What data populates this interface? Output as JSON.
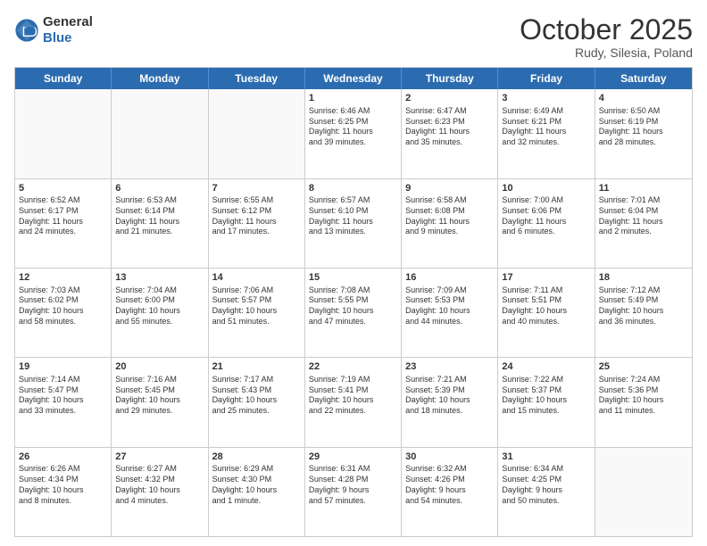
{
  "header": {
    "logo_general": "General",
    "logo_blue": "Blue",
    "month": "October 2025",
    "location": "Rudy, Silesia, Poland"
  },
  "weekdays": [
    "Sunday",
    "Monday",
    "Tuesday",
    "Wednesday",
    "Thursday",
    "Friday",
    "Saturday"
  ],
  "weeks": [
    [
      {
        "day": "",
        "text": ""
      },
      {
        "day": "",
        "text": ""
      },
      {
        "day": "",
        "text": ""
      },
      {
        "day": "1",
        "text": "Sunrise: 6:46 AM\nSunset: 6:25 PM\nDaylight: 11 hours\nand 39 minutes."
      },
      {
        "day": "2",
        "text": "Sunrise: 6:47 AM\nSunset: 6:23 PM\nDaylight: 11 hours\nand 35 minutes."
      },
      {
        "day": "3",
        "text": "Sunrise: 6:49 AM\nSunset: 6:21 PM\nDaylight: 11 hours\nand 32 minutes."
      },
      {
        "day": "4",
        "text": "Sunrise: 6:50 AM\nSunset: 6:19 PM\nDaylight: 11 hours\nand 28 minutes."
      }
    ],
    [
      {
        "day": "5",
        "text": "Sunrise: 6:52 AM\nSunset: 6:17 PM\nDaylight: 11 hours\nand 24 minutes."
      },
      {
        "day": "6",
        "text": "Sunrise: 6:53 AM\nSunset: 6:14 PM\nDaylight: 11 hours\nand 21 minutes."
      },
      {
        "day": "7",
        "text": "Sunrise: 6:55 AM\nSunset: 6:12 PM\nDaylight: 11 hours\nand 17 minutes."
      },
      {
        "day": "8",
        "text": "Sunrise: 6:57 AM\nSunset: 6:10 PM\nDaylight: 11 hours\nand 13 minutes."
      },
      {
        "day": "9",
        "text": "Sunrise: 6:58 AM\nSunset: 6:08 PM\nDaylight: 11 hours\nand 9 minutes."
      },
      {
        "day": "10",
        "text": "Sunrise: 7:00 AM\nSunset: 6:06 PM\nDaylight: 11 hours\nand 6 minutes."
      },
      {
        "day": "11",
        "text": "Sunrise: 7:01 AM\nSunset: 6:04 PM\nDaylight: 11 hours\nand 2 minutes."
      }
    ],
    [
      {
        "day": "12",
        "text": "Sunrise: 7:03 AM\nSunset: 6:02 PM\nDaylight: 10 hours\nand 58 minutes."
      },
      {
        "day": "13",
        "text": "Sunrise: 7:04 AM\nSunset: 6:00 PM\nDaylight: 10 hours\nand 55 minutes."
      },
      {
        "day": "14",
        "text": "Sunrise: 7:06 AM\nSunset: 5:57 PM\nDaylight: 10 hours\nand 51 minutes."
      },
      {
        "day": "15",
        "text": "Sunrise: 7:08 AM\nSunset: 5:55 PM\nDaylight: 10 hours\nand 47 minutes."
      },
      {
        "day": "16",
        "text": "Sunrise: 7:09 AM\nSunset: 5:53 PM\nDaylight: 10 hours\nand 44 minutes."
      },
      {
        "day": "17",
        "text": "Sunrise: 7:11 AM\nSunset: 5:51 PM\nDaylight: 10 hours\nand 40 minutes."
      },
      {
        "day": "18",
        "text": "Sunrise: 7:12 AM\nSunset: 5:49 PM\nDaylight: 10 hours\nand 36 minutes."
      }
    ],
    [
      {
        "day": "19",
        "text": "Sunrise: 7:14 AM\nSunset: 5:47 PM\nDaylight: 10 hours\nand 33 minutes."
      },
      {
        "day": "20",
        "text": "Sunrise: 7:16 AM\nSunset: 5:45 PM\nDaylight: 10 hours\nand 29 minutes."
      },
      {
        "day": "21",
        "text": "Sunrise: 7:17 AM\nSunset: 5:43 PM\nDaylight: 10 hours\nand 25 minutes."
      },
      {
        "day": "22",
        "text": "Sunrise: 7:19 AM\nSunset: 5:41 PM\nDaylight: 10 hours\nand 22 minutes."
      },
      {
        "day": "23",
        "text": "Sunrise: 7:21 AM\nSunset: 5:39 PM\nDaylight: 10 hours\nand 18 minutes."
      },
      {
        "day": "24",
        "text": "Sunrise: 7:22 AM\nSunset: 5:37 PM\nDaylight: 10 hours\nand 15 minutes."
      },
      {
        "day": "25",
        "text": "Sunrise: 7:24 AM\nSunset: 5:36 PM\nDaylight: 10 hours\nand 11 minutes."
      }
    ],
    [
      {
        "day": "26",
        "text": "Sunrise: 6:26 AM\nSunset: 4:34 PM\nDaylight: 10 hours\nand 8 minutes."
      },
      {
        "day": "27",
        "text": "Sunrise: 6:27 AM\nSunset: 4:32 PM\nDaylight: 10 hours\nand 4 minutes."
      },
      {
        "day": "28",
        "text": "Sunrise: 6:29 AM\nSunset: 4:30 PM\nDaylight: 10 hours\nand 1 minute."
      },
      {
        "day": "29",
        "text": "Sunrise: 6:31 AM\nSunset: 4:28 PM\nDaylight: 9 hours\nand 57 minutes."
      },
      {
        "day": "30",
        "text": "Sunrise: 6:32 AM\nSunset: 4:26 PM\nDaylight: 9 hours\nand 54 minutes."
      },
      {
        "day": "31",
        "text": "Sunrise: 6:34 AM\nSunset: 4:25 PM\nDaylight: 9 hours\nand 50 minutes."
      },
      {
        "day": "",
        "text": ""
      }
    ]
  ]
}
